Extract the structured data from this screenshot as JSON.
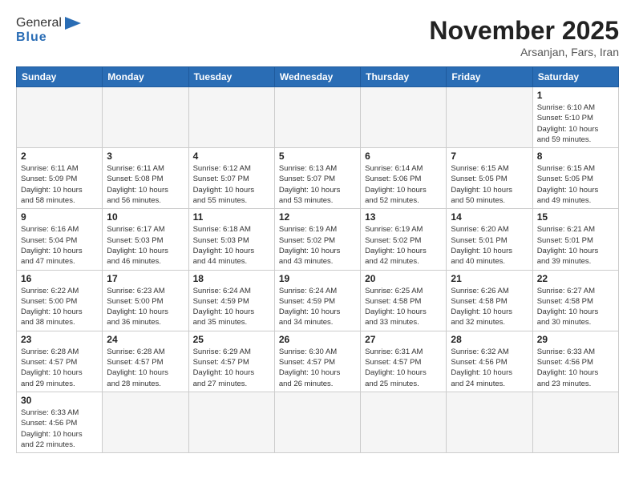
{
  "header": {
    "logo_general": "General",
    "logo_blue": "Blue",
    "month_title": "November 2025",
    "location": "Arsanjan, Fars, Iran"
  },
  "days_of_week": [
    "Sunday",
    "Monday",
    "Tuesday",
    "Wednesday",
    "Thursday",
    "Friday",
    "Saturday"
  ],
  "weeks": [
    {
      "days": [
        {
          "num": "",
          "info": ""
        },
        {
          "num": "",
          "info": ""
        },
        {
          "num": "",
          "info": ""
        },
        {
          "num": "",
          "info": ""
        },
        {
          "num": "",
          "info": ""
        },
        {
          "num": "",
          "info": ""
        },
        {
          "num": "1",
          "info": "Sunrise: 6:10 AM\nSunset: 5:10 PM\nDaylight: 10 hours\nand 59 minutes."
        }
      ]
    },
    {
      "days": [
        {
          "num": "2",
          "info": "Sunrise: 6:11 AM\nSunset: 5:09 PM\nDaylight: 10 hours\nand 58 minutes."
        },
        {
          "num": "3",
          "info": "Sunrise: 6:11 AM\nSunset: 5:08 PM\nDaylight: 10 hours\nand 56 minutes."
        },
        {
          "num": "4",
          "info": "Sunrise: 6:12 AM\nSunset: 5:07 PM\nDaylight: 10 hours\nand 55 minutes."
        },
        {
          "num": "5",
          "info": "Sunrise: 6:13 AM\nSunset: 5:07 PM\nDaylight: 10 hours\nand 53 minutes."
        },
        {
          "num": "6",
          "info": "Sunrise: 6:14 AM\nSunset: 5:06 PM\nDaylight: 10 hours\nand 52 minutes."
        },
        {
          "num": "7",
          "info": "Sunrise: 6:15 AM\nSunset: 5:05 PM\nDaylight: 10 hours\nand 50 minutes."
        },
        {
          "num": "8",
          "info": "Sunrise: 6:15 AM\nSunset: 5:05 PM\nDaylight: 10 hours\nand 49 minutes."
        }
      ]
    },
    {
      "days": [
        {
          "num": "9",
          "info": "Sunrise: 6:16 AM\nSunset: 5:04 PM\nDaylight: 10 hours\nand 47 minutes."
        },
        {
          "num": "10",
          "info": "Sunrise: 6:17 AM\nSunset: 5:03 PM\nDaylight: 10 hours\nand 46 minutes."
        },
        {
          "num": "11",
          "info": "Sunrise: 6:18 AM\nSunset: 5:03 PM\nDaylight: 10 hours\nand 44 minutes."
        },
        {
          "num": "12",
          "info": "Sunrise: 6:19 AM\nSunset: 5:02 PM\nDaylight: 10 hours\nand 43 minutes."
        },
        {
          "num": "13",
          "info": "Sunrise: 6:19 AM\nSunset: 5:02 PM\nDaylight: 10 hours\nand 42 minutes."
        },
        {
          "num": "14",
          "info": "Sunrise: 6:20 AM\nSunset: 5:01 PM\nDaylight: 10 hours\nand 40 minutes."
        },
        {
          "num": "15",
          "info": "Sunrise: 6:21 AM\nSunset: 5:01 PM\nDaylight: 10 hours\nand 39 minutes."
        }
      ]
    },
    {
      "days": [
        {
          "num": "16",
          "info": "Sunrise: 6:22 AM\nSunset: 5:00 PM\nDaylight: 10 hours\nand 38 minutes."
        },
        {
          "num": "17",
          "info": "Sunrise: 6:23 AM\nSunset: 5:00 PM\nDaylight: 10 hours\nand 36 minutes."
        },
        {
          "num": "18",
          "info": "Sunrise: 6:24 AM\nSunset: 4:59 PM\nDaylight: 10 hours\nand 35 minutes."
        },
        {
          "num": "19",
          "info": "Sunrise: 6:24 AM\nSunset: 4:59 PM\nDaylight: 10 hours\nand 34 minutes."
        },
        {
          "num": "20",
          "info": "Sunrise: 6:25 AM\nSunset: 4:58 PM\nDaylight: 10 hours\nand 33 minutes."
        },
        {
          "num": "21",
          "info": "Sunrise: 6:26 AM\nSunset: 4:58 PM\nDaylight: 10 hours\nand 32 minutes."
        },
        {
          "num": "22",
          "info": "Sunrise: 6:27 AM\nSunset: 4:58 PM\nDaylight: 10 hours\nand 30 minutes."
        }
      ]
    },
    {
      "days": [
        {
          "num": "23",
          "info": "Sunrise: 6:28 AM\nSunset: 4:57 PM\nDaylight: 10 hours\nand 29 minutes."
        },
        {
          "num": "24",
          "info": "Sunrise: 6:28 AM\nSunset: 4:57 PM\nDaylight: 10 hours\nand 28 minutes."
        },
        {
          "num": "25",
          "info": "Sunrise: 6:29 AM\nSunset: 4:57 PM\nDaylight: 10 hours\nand 27 minutes."
        },
        {
          "num": "26",
          "info": "Sunrise: 6:30 AM\nSunset: 4:57 PM\nDaylight: 10 hours\nand 26 minutes."
        },
        {
          "num": "27",
          "info": "Sunrise: 6:31 AM\nSunset: 4:57 PM\nDaylight: 10 hours\nand 25 minutes."
        },
        {
          "num": "28",
          "info": "Sunrise: 6:32 AM\nSunset: 4:56 PM\nDaylight: 10 hours\nand 24 minutes."
        },
        {
          "num": "29",
          "info": "Sunrise: 6:33 AM\nSunset: 4:56 PM\nDaylight: 10 hours\nand 23 minutes."
        }
      ]
    },
    {
      "days": [
        {
          "num": "30",
          "info": "Sunrise: 6:33 AM\nSunset: 4:56 PM\nDaylight: 10 hours\nand 22 minutes."
        },
        {
          "num": "",
          "info": ""
        },
        {
          "num": "",
          "info": ""
        },
        {
          "num": "",
          "info": ""
        },
        {
          "num": "",
          "info": ""
        },
        {
          "num": "",
          "info": ""
        },
        {
          "num": "",
          "info": ""
        }
      ]
    }
  ]
}
